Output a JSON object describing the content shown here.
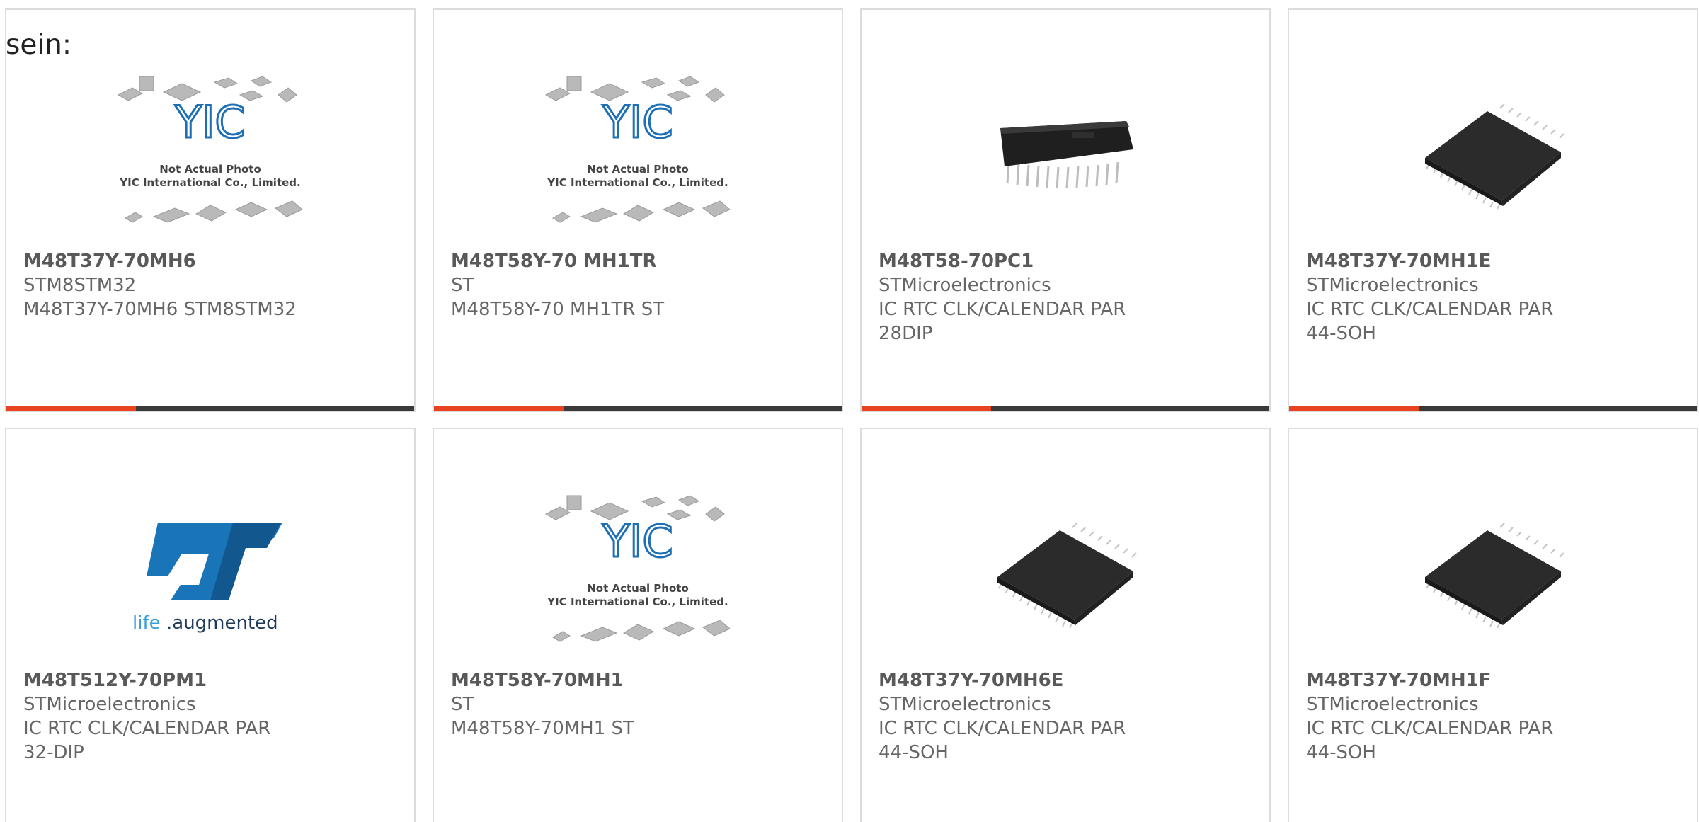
{
  "page": {
    "lead_text": "sein:"
  },
  "colors": {
    "accent": "#e8421e",
    "bar": "#3a3a3a",
    "border": "#dcdcdc",
    "text": "#666666",
    "yic_blue": "#1e6fb5",
    "st_blue": "#1a74b8"
  },
  "placeholder": {
    "brand": "YIC",
    "line1": "Not Actual Photo",
    "line2": "YIC International Co., Limited."
  },
  "st_logo": {
    "mark": "ST",
    "tagline_a": "life",
    "tagline_b": ".augmented"
  },
  "products": [
    {
      "part": "M48T37Y-70MH6",
      "maker": "STM8STM32",
      "desc": "M48T37Y-70MH6 STM8STM32",
      "image": "placeholder-image"
    },
    {
      "part": "M48T58Y-70 MH1TR",
      "maker": "ST",
      "desc": "M48T58Y-70 MH1TR ST",
      "image": "placeholder-image"
    },
    {
      "part": "M48T58-70PC1",
      "maker": "STMicroelectronics",
      "desc": "IC RTC CLK/CALENDAR PAR 28DIP",
      "image": "dip-chip-photo"
    },
    {
      "part": "M48T37Y-70MH1E",
      "maker": "STMicroelectronics",
      "desc": "IC RTC CLK/CALENDAR PAR 44-SOH",
      "image": "soh-chip-photo"
    },
    {
      "part": "M48T512Y-70PM1",
      "maker": "STMicroelectronics",
      "desc": "IC RTC CLK/CALENDAR PAR 32-DIP",
      "image": "st-logo"
    },
    {
      "part": "M48T58Y-70MH1",
      "maker": "ST",
      "desc": "M48T58Y-70MH1 ST",
      "image": "placeholder-image"
    },
    {
      "part": "M48T37Y-70MH6E",
      "maker": "STMicroelectronics",
      "desc": "IC RTC CLK/CALENDAR PAR 44-SOH",
      "image": "soh-chip-photo"
    },
    {
      "part": "M48T37Y-70MH1F",
      "maker": "STMicroelectronics",
      "desc": "IC RTC CLK/CALENDAR PAR 44-SOH",
      "image": "soh-chip-photo"
    }
  ]
}
